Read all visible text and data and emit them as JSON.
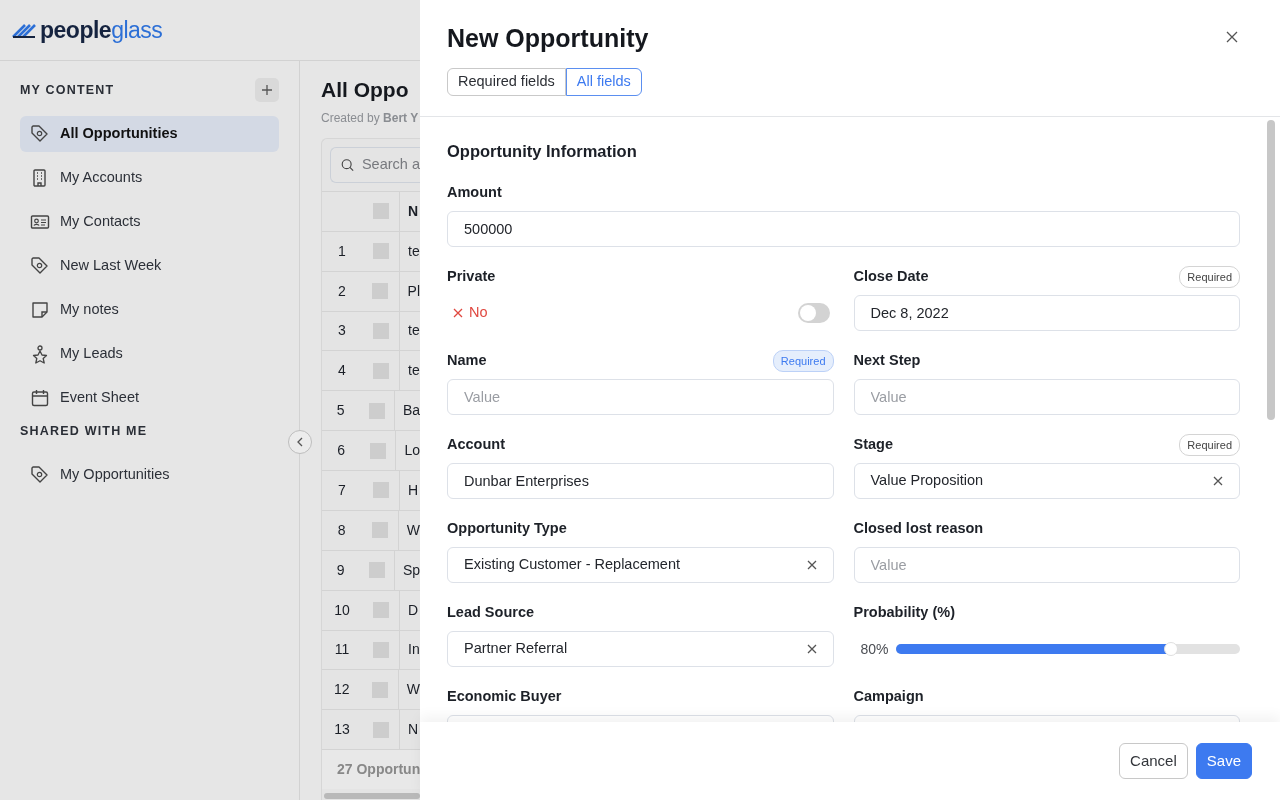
{
  "logo": {
    "part_1": "people",
    "part_2": "glass"
  },
  "sidebar": {
    "sections": [
      {
        "title": "MY CONTENT",
        "items": [
          {
            "label": "All Opportunities",
            "selected": true
          },
          {
            "label": "My Accounts",
            "selected": false
          },
          {
            "label": "My Contacts",
            "selected": false
          },
          {
            "label": "New Last Week",
            "selected": false
          },
          {
            "label": "My notes",
            "selected": false
          },
          {
            "label": "My Leads",
            "selected": false
          },
          {
            "label": "Event Sheet",
            "selected": false
          }
        ]
      },
      {
        "title": "SHARED WITH ME",
        "items": [
          {
            "label": "My Opportunities",
            "selected": false
          }
        ]
      }
    ]
  },
  "list_view": {
    "title": "All Oppo",
    "subtitle": "Created by **Bert Y**",
    "search_placeholder": "Search a",
    "select_all_checked": false,
    "columns": [
      "N"
    ],
    "rows": [
      {
        "number": "1",
        "name": "te",
        "checked": false
      },
      {
        "number": "2",
        "name": "Pl",
        "checked": false
      },
      {
        "number": "3",
        "name": "te",
        "checked": false
      },
      {
        "number": "4",
        "name": "te",
        "checked": false
      },
      {
        "number": "5",
        "name": "Ba",
        "checked": false
      },
      {
        "number": "6",
        "name": "Lo",
        "checked": false
      },
      {
        "number": "7",
        "name": "H",
        "checked": false
      },
      {
        "number": "8",
        "name": "W",
        "checked": false
      },
      {
        "number": "9",
        "name": "Sp",
        "checked": false
      },
      {
        "number": "10",
        "name": "D",
        "checked": false
      },
      {
        "number": "11",
        "name": "In",
        "checked": false
      },
      {
        "number": "12",
        "name": "W",
        "checked": false
      },
      {
        "number": "13",
        "name": "N",
        "checked": false
      }
    ],
    "footer": "27 Opportun"
  },
  "drawer": {
    "title": "New Opportunity",
    "tabs": [
      {
        "label": "Required fields",
        "selected": false
      },
      {
        "label": "All fields",
        "selected": true
      }
    ],
    "section_title": "Opportunity Information",
    "fields": [
      {
        "label": "Amount",
        "kind": "text",
        "wide": true,
        "value": "500000"
      },
      {
        "label": "Private",
        "kind": "toggle",
        "value": "No",
        "on": false
      },
      {
        "label": "Close Date",
        "kind": "text",
        "value": "Dec 8, 2022",
        "badge": {
          "text": "Required",
          "highlighted": false
        }
      },
      {
        "label": "Name",
        "kind": "text",
        "placeholder": "Value",
        "badge": {
          "text": "Required",
          "highlighted": true
        }
      },
      {
        "label": "Next Step",
        "kind": "text",
        "placeholder": "Value"
      },
      {
        "label": "Account",
        "kind": "text",
        "value": "Dunbar Enterprises"
      },
      {
        "label": "Stage",
        "kind": "select",
        "value": "Value Proposition",
        "badge": {
          "text": "Required",
          "highlighted": false
        }
      },
      {
        "label": "Opportunity Type",
        "kind": "select",
        "value": "Existing Customer - Replacement"
      },
      {
        "label": "Closed lost reason",
        "kind": "text",
        "placeholder": "Value"
      },
      {
        "label": "Lead Source",
        "kind": "select",
        "value": "Partner Referral"
      },
      {
        "label": "Probability (%)",
        "kind": "slider",
        "reading": "80%",
        "level": 0.8
      },
      {
        "label": "Economic Buyer",
        "kind": "text"
      },
      {
        "label": "Campaign",
        "kind": "text"
      }
    ],
    "buttons": [
      {
        "label": "Cancel",
        "kind": "secondary"
      },
      {
        "label": "Save",
        "kind": "primary"
      }
    ]
  }
}
